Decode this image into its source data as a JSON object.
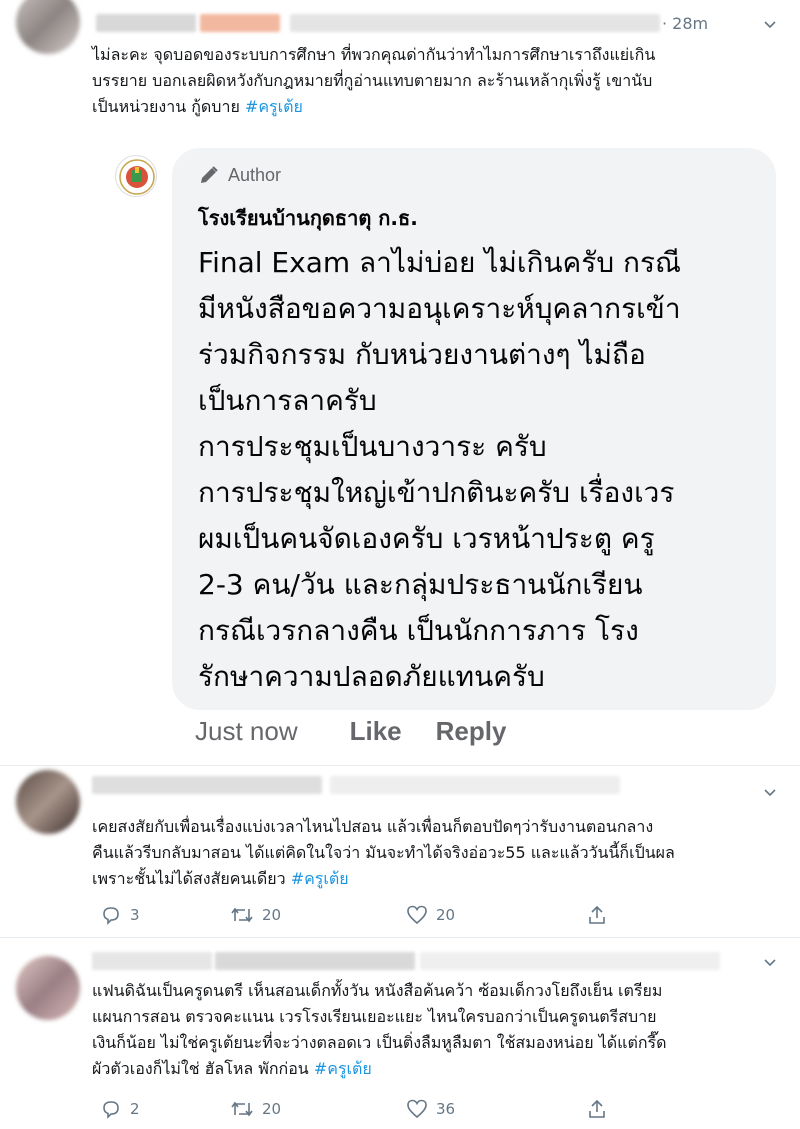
{
  "tweet1": {
    "time": "· 28m",
    "lines": [
      "ไม่ละคะ จุดบอดของระบบการศึกษา ที่พวกคุณด่ากันว่าทำไมการศึกษาเราถึงแย่เกิน",
      "บรรยาย บอกเลยผิดหวังกับกฎหมายที่กูอ่านแทบตายมาก ละร้านเหล้ากุเพิ่งรู้ เขานับ",
      "เป็นหน่วยงาน กู้ดบาย "
    ],
    "hashtag": "#ครูเต้ย"
  },
  "reply_card": {
    "author_badge": "Author",
    "author_name": "โรงเรียนบ้านกุดธาตุ ก.ธ.",
    "body_lines": [
      "Final Exam ลาไม่บ่อย ไม่เกินครับ กรณี",
      "มีหนังสือขอความอนุเคราะห์บุคลากรเข้า",
      "ร่วมกิจกรรม กับหน่วยงานต่างๆ ไม่ถือ",
      "เป็นการลาครับ",
      "การประชุมเป็นบางวาระ ครับ",
      "การประชุมใหญ่เข้าปกตินะครับ เรื่องเวร",
      "ผมเป็นคนจัดเองครับ เวรหน้าประตู ครู",
      "2-3 คน/วัน และกลุ่มประธานนักเรียน",
      "กรณีเวรกลางคืน เป็นนักการภาร โรง",
      "รักษาความปลอดภัยแทนครับ"
    ],
    "meta_time": "Just now",
    "like_label": "Like",
    "reply_label": "Reply"
  },
  "tweet2": {
    "lines": [
      "เคยสงสัยกับเพื่อนเรื่องแบ่งเวลาไหนไปสอน แล้วเพื่อนก็ตอบปัดๆว่ารับงานตอนกลาง",
      "คืนแล้วรีบกลับมาสอน ได้แต่คิดในใจว่า มันจะทำได้จริงอ่อวะ55 และแล้ววันนี้ก็เป็นผล",
      "เพราะชั้นไม่ได้สงสัยคนเดียว "
    ],
    "hashtag": "#ครูเต้ย",
    "replies": "3",
    "retweets": "20",
    "likes": "20"
  },
  "tweet3": {
    "lines": [
      "แฟนดิฉันเป็นครูดนตรี เห็นสอนเด็กทั้งวัน หนังสือค้นคว้า ซ้อมเด็กวงโยถึงเย็น เตรียม",
      "แผนการสอน ตรวจคะแนน เวรโรงเรียนเยอะแยะ ไหนใครบอกว่าเป็นครูดนตรีสบาย",
      "เงินก็น้อย ไม่ใช่ครูเต้ยนะที่จะว่างตลอดเว เป็นติ่งลืมหูลืมตา ใช้สมองหน่อย ได้แต่กรี๊ด",
      "ผัวตัวเองก็ไม่ใช่ ฮัลโหล พักก่อน "
    ],
    "hashtag": "#ครูเต้ย",
    "replies": "2",
    "retweets": "20",
    "likes": "36"
  },
  "colors": {
    "hashtag": "#1b95e0",
    "muted": "#657786",
    "bubble": "#f2f3f5"
  }
}
